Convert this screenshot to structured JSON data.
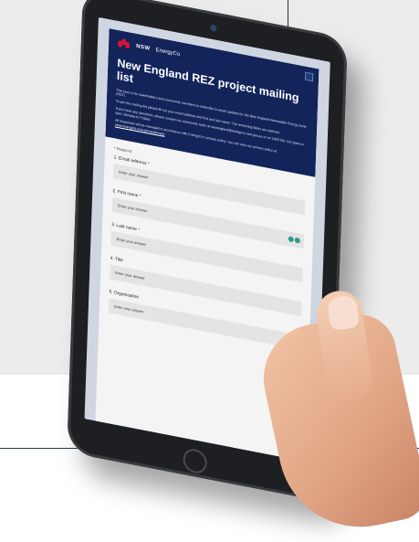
{
  "form": {
    "brand_nsw": "NSW",
    "brand_name": "EnergyCo",
    "title": "New England REZ project mailing list",
    "intro_1": "This form is for stakeholders and community members to subscribe to email updates for the New England Renewable Energy Zone (REZ).",
    "intro_2": "To join the mailing list please fill out your email address and first and last name. The remaining fields are optional.",
    "intro_3": "If you have any questions, please contact our community team at newengland@energyco.nsw.gov.au or on 1800 061 114 (9am to 5pm, Monday to Friday).",
    "intro_4_prefix": "All responses will be managed in accordance with EnergyCo's privacy policy. You can view our privacy policy at",
    "intro_4_link": "www.energyco.nsw.gov.au/privacy",
    "required_note": "* Required",
    "questions": [
      {
        "label": "1. Email address",
        "required": "*",
        "placeholder": "Enter your answer"
      },
      {
        "label": "2. First name",
        "required": "*",
        "placeholder": "Enter your answer"
      },
      {
        "label": "3. Last name",
        "required": "*",
        "placeholder": "Enter your answer"
      },
      {
        "label": "4. Title",
        "required": "",
        "placeholder": "Enter your answer"
      },
      {
        "label": "5. Organisation",
        "required": "",
        "placeholder": "Enter your answer"
      }
    ]
  },
  "colors": {
    "banner": "#12245a",
    "accent_red": "#d7153a",
    "page_bg": "#ececec"
  },
  "icons": [
    "waratah-logo-icon",
    "close-icon",
    "immersive-reader-icon"
  ]
}
